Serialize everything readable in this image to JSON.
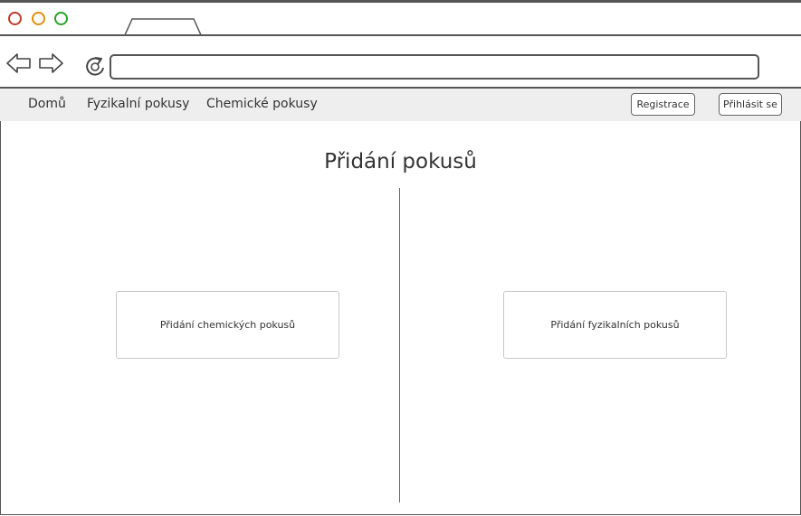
{
  "browser": {
    "window_buttons": [
      "close",
      "minimize",
      "maximize"
    ],
    "icons": [
      "back-arrow-icon",
      "forward-arrow-icon",
      "reload-icon"
    ],
    "address_value": ""
  },
  "menu": {
    "items": [
      {
        "label": "Domů"
      },
      {
        "label": "Fyzikalní pokusy"
      },
      {
        "label": "Chemické pokusy"
      }
    ],
    "register_label": "Registrace",
    "login_label": "Přihlásit se"
  },
  "main": {
    "title": "Přidání pokusů",
    "add_chemical_label": "Přidání chemických pokusů",
    "add_physical_label": "Přidání fyzikalních pokusů"
  },
  "colors": {
    "close": "#c0392b",
    "minimize": "#e08e0b",
    "maximize": "#27a327",
    "menubar_bg": "#eeeeee"
  }
}
